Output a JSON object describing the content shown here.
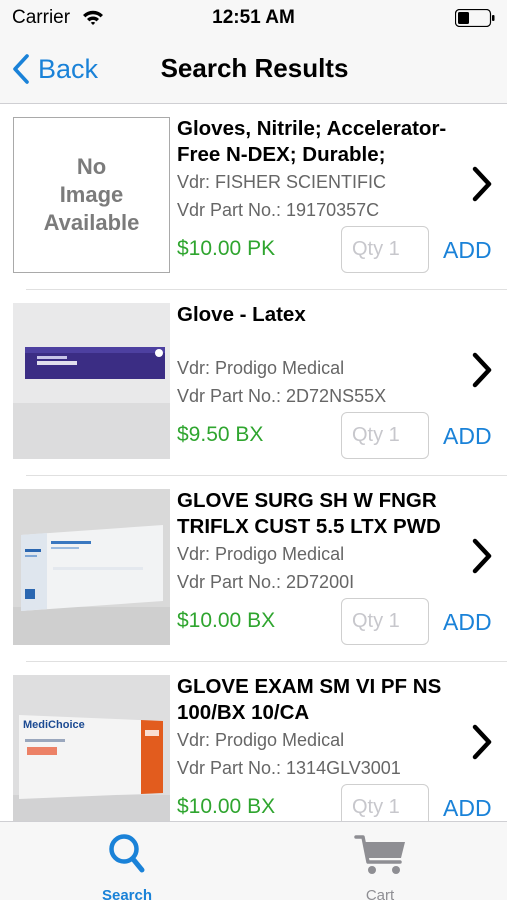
{
  "status_bar": {
    "carrier": "Carrier",
    "time": "12:51 AM"
  },
  "nav": {
    "back_label": "Back",
    "title": "Search Results"
  },
  "accent_color": "#1a82d8",
  "price_color": "#2fa52f",
  "items": [
    {
      "title": "Gloves, Nitrile; Accelerator-\nFree N-DEX; Durable;",
      "image": "No\nImage\nAvailable",
      "vendor": "Vdr: FISHER SCIENTIFIC",
      "part": "Vdr Part No.: 19170357C",
      "price": "$10.00 PK",
      "qty_placeholder": "Qty 1",
      "add_label": "ADD"
    },
    {
      "title": "Glove - Latex",
      "vendor": "Vdr: Prodigo Medical",
      "part": "Vdr Part No.: 2D72NS55X",
      "price": "$9.50 BX",
      "qty_placeholder": "Qty 1",
      "add_label": "ADD"
    },
    {
      "title": "GLOVE SURG SH W FNGR\nTRIFLX CUST 5.5 LTX PWD",
      "vendor": "Vdr: Prodigo Medical",
      "part": "Vdr Part No.: 2D7200I",
      "price": "$10.00 BX",
      "qty_placeholder": "Qty 1",
      "add_label": "ADD"
    },
    {
      "title": "GLOVE EXAM SM VI PF NS\n100/BX  10/CA",
      "image_label": "MediChoice",
      "vendor": "Vdr: Prodigo Medical",
      "part": "Vdr Part No.: 1314GLV3001",
      "price": "$10.00 BX",
      "qty_placeholder": "Qty 1",
      "add_label": "ADD"
    }
  ],
  "tabs": [
    {
      "label": "Search",
      "icon": "search-icon",
      "selected": true
    },
    {
      "label": "Cart",
      "icon": "cart-icon",
      "selected": false
    }
  ]
}
